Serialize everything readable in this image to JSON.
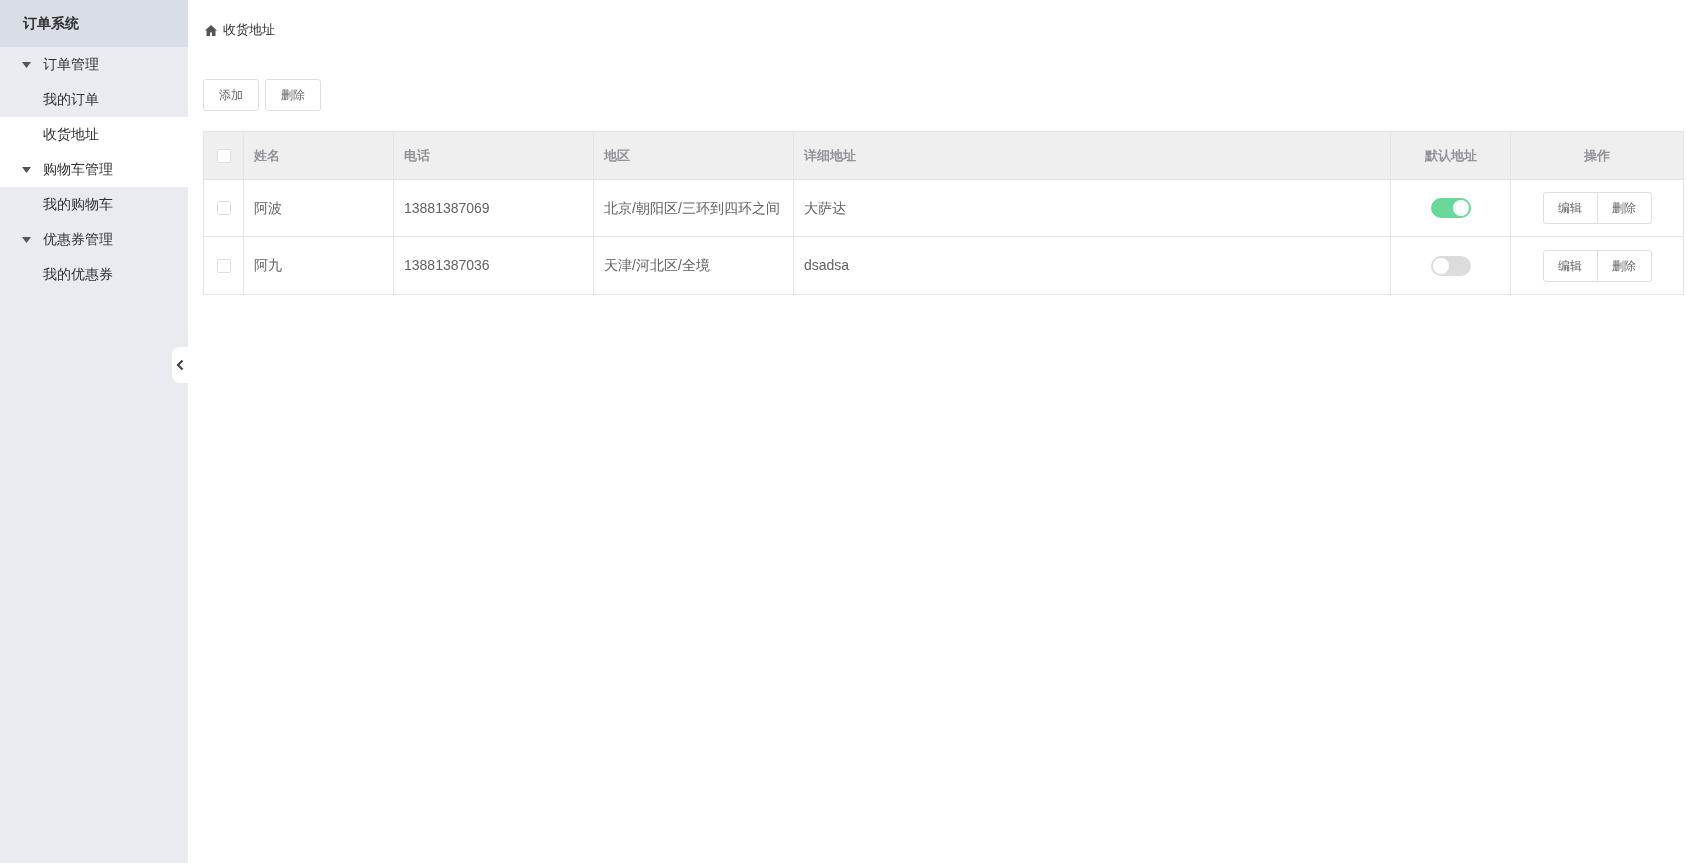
{
  "sidebar": {
    "title": "订单系统",
    "groups": [
      {
        "label": "订单管理",
        "expanded": true,
        "hovered": false,
        "items": [
          {
            "label": "我的订单",
            "selected": false
          },
          {
            "label": "收货地址",
            "selected": true
          }
        ]
      },
      {
        "label": "购物车管理",
        "expanded": true,
        "hovered": true,
        "items": [
          {
            "label": "我的购物车",
            "selected": false
          }
        ]
      },
      {
        "label": "优惠券管理",
        "expanded": true,
        "hovered": false,
        "items": [
          {
            "label": "我的优惠券",
            "selected": false
          }
        ]
      }
    ]
  },
  "breadcrumb": "收货地址",
  "toolbar": [
    "添加",
    "删除"
  ],
  "table": {
    "select_all": {
      "checked": false
    },
    "columns": [
      "姓名",
      "电话",
      "地区",
      "详细地址",
      "默认地址",
      "操作"
    ],
    "rows": [
      {
        "checked": false,
        "name": "阿波",
        "phone": "13881387069",
        "region": "北京/朝阳区/三环到四环之间",
        "detail": "大萨达",
        "default": true,
        "actions": [
          "编辑",
          "删除"
        ]
      },
      {
        "checked": false,
        "name": "阿九",
        "phone": "13881387036",
        "region": "天津/河北区/全境",
        "detail": "dsadsa",
        "default": false,
        "actions": [
          "编辑",
          "删除"
        ]
      }
    ]
  }
}
